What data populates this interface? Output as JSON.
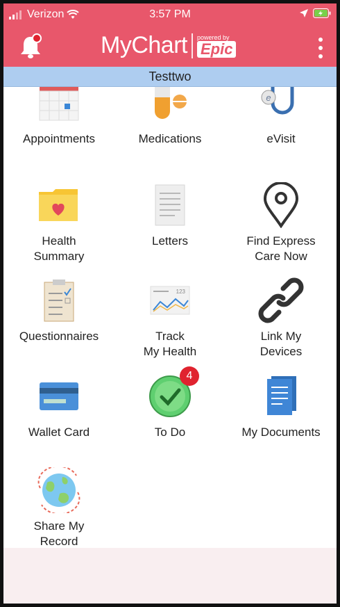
{
  "status_bar": {
    "carrier": "Verizon",
    "time": "3:57 PM"
  },
  "header": {
    "logo_main": "MyChart",
    "logo_powered": "powered by",
    "logo_brand": "Epic",
    "accent_color": "#e8576b"
  },
  "patient": {
    "name": "Testtwo"
  },
  "tiles": [
    {
      "label": "Appointments",
      "icon": "calendar-icon"
    },
    {
      "label": "Medications",
      "icon": "pill-icon"
    },
    {
      "label": "eVisit",
      "icon": "stethoscope-icon"
    },
    {
      "label": "Health\nSummary",
      "icon": "heart-folder-icon"
    },
    {
      "label": "Letters",
      "icon": "letter-document-icon"
    },
    {
      "label": "Find Express\nCare Now",
      "icon": "map-pin-icon"
    },
    {
      "label": "Questionnaires",
      "icon": "clipboard-icon"
    },
    {
      "label": "Track\nMy Health",
      "icon": "chart-tracker-icon"
    },
    {
      "label": "Link My\nDevices",
      "icon": "link-chain-icon"
    },
    {
      "label": "Wallet Card",
      "icon": "credit-card-icon"
    },
    {
      "label": "To Do",
      "icon": "checkmark-clock-icon",
      "badge": "4"
    },
    {
      "label": "My Documents",
      "icon": "documents-stack-icon"
    },
    {
      "label": "Share My\nRecord",
      "icon": "globe-share-icon"
    }
  ]
}
